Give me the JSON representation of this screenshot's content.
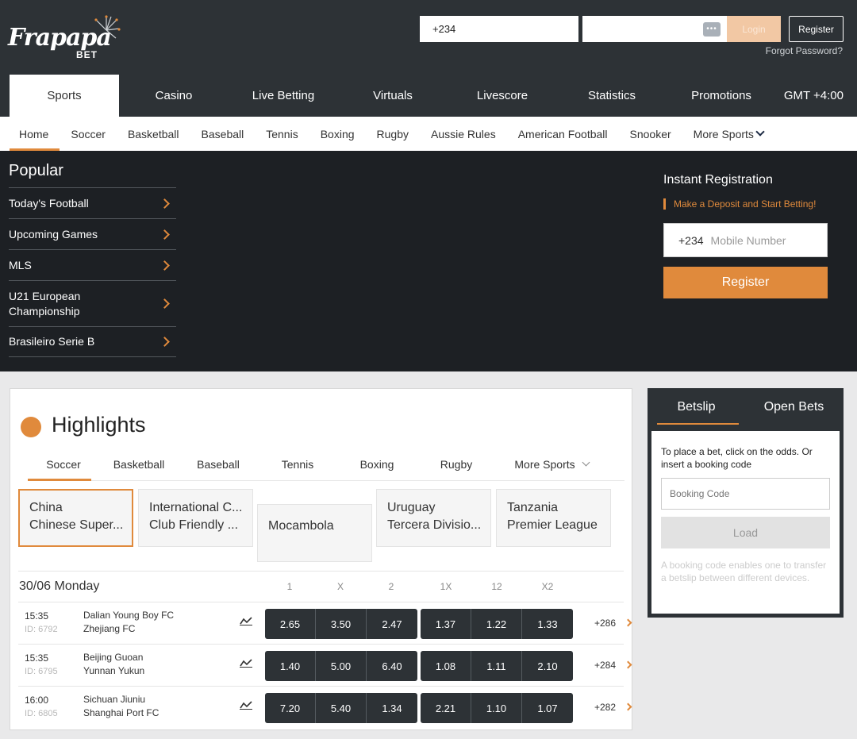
{
  "header": {
    "logo_text": "Frapapa",
    "logo_sub": "BET",
    "phone_value": "+234",
    "password_value": "",
    "password_toggle": "•••",
    "login_label": "Login",
    "register_label": "Register",
    "forgot_label": "Forgot Password?",
    "timezone": "GMT +4:00"
  },
  "main_nav": [
    {
      "label": "Sports",
      "active": true
    },
    {
      "label": "Casino"
    },
    {
      "label": "Live Betting"
    },
    {
      "label": "Virtuals"
    },
    {
      "label": "Livescore"
    },
    {
      "label": "Statistics"
    },
    {
      "label": "Promotions"
    }
  ],
  "sub_nav": [
    "Home",
    "Soccer",
    "Basketball",
    "Baseball",
    "Tennis",
    "Boxing",
    "Rugby",
    "Aussie Rules",
    "American Football",
    "Snooker"
  ],
  "sub_nav_more": "More Sports",
  "popular": {
    "title": "Popular",
    "items": [
      "Today's Football",
      "Upcoming Games",
      "MLS",
      "U21 European",
      "Championship",
      "Brasileiro Serie B"
    ]
  },
  "registration": {
    "title": "Instant Registration",
    "subtitle": "Make a Deposit and Start Betting!",
    "country_code": "+234",
    "placeholder": "Mobile Number",
    "button": "Register"
  },
  "highlights": {
    "title": "Highlights",
    "tabs": [
      "Soccer",
      "Basketball",
      "Baseball",
      "Tennis",
      "Boxing",
      "Rugby",
      "More Sports"
    ],
    "leagues": [
      {
        "line1": "China",
        "line2": "Chinese Super..."
      },
      {
        "line1": "International C...",
        "line2": "Club Friendly ..."
      },
      {
        "line1": "Mocambola",
        "line2": ""
      },
      {
        "line1": "Uruguay",
        "line2": "Tercera Divisio..."
      },
      {
        "line1": "Tanzania",
        "line2": "Premier League"
      }
    ],
    "date": "30/06 Monday",
    "columns": [
      "1",
      "X",
      "2",
      "1X",
      "12",
      "X2"
    ],
    "matches": [
      {
        "time": "15:35",
        "id": "ID: 6792",
        "home": "Dalian Young Boy FC",
        "away": "Zhejiang FC",
        "odds": [
          "2.65",
          "3.50",
          "2.47",
          "1.37",
          "1.22",
          "1.33"
        ],
        "more": "+286"
      },
      {
        "time": "15:35",
        "id": "ID: 6795",
        "home": "Beijing Guoan",
        "away": "Yunnan Yukun",
        "odds": [
          "1.40",
          "5.00",
          "6.40",
          "1.08",
          "1.11",
          "2.10"
        ],
        "more": "+284"
      },
      {
        "time": "16:00",
        "id": "ID: 6805",
        "home": "Sichuan Jiuniu",
        "away": "Shanghai Port FC",
        "odds": [
          "7.20",
          "5.40",
          "1.34",
          "2.21",
          "1.10",
          "1.07"
        ],
        "more": "+282"
      }
    ]
  },
  "betslip": {
    "tab_betslip": "Betslip",
    "tab_open": "Open Bets",
    "text": "To place a bet, click on the odds. Or insert a booking code",
    "placeholder": "Booking Code",
    "load": "Load",
    "note": "A booking code enables one to transfer a betslip between different devices."
  },
  "colors": {
    "accent": "#e08a3c",
    "header_bg": "#2d3236",
    "hero_bg": "#1d2024"
  }
}
